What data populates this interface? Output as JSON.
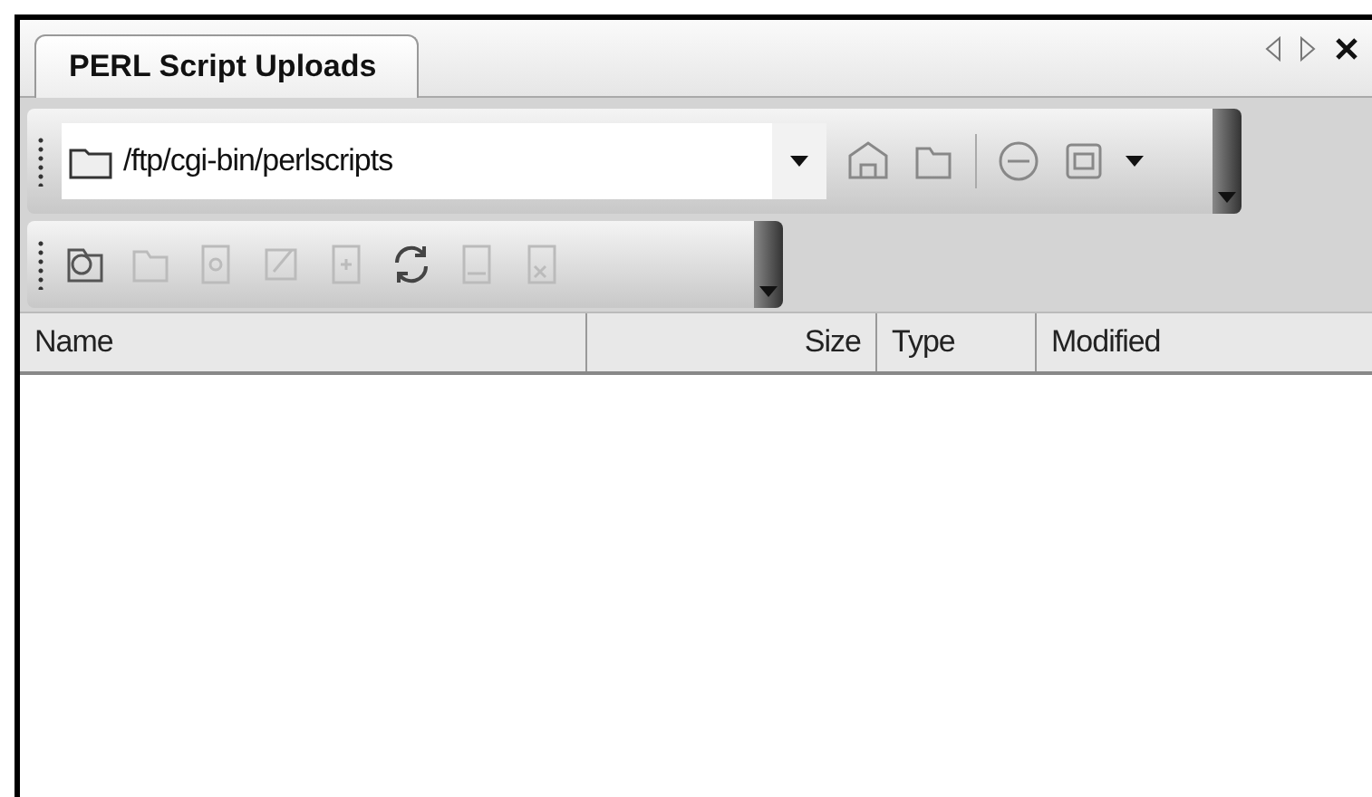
{
  "tab": {
    "label": "PERL Script Uploads",
    "selected": true
  },
  "path_field": {
    "value": "/ftp/cgi-bin/perlscripts"
  },
  "table": {
    "columns": [
      {
        "label": "Name"
      },
      {
        "label": "Size"
      },
      {
        "label": "Type"
      },
      {
        "label": "Modified"
      }
    ]
  }
}
